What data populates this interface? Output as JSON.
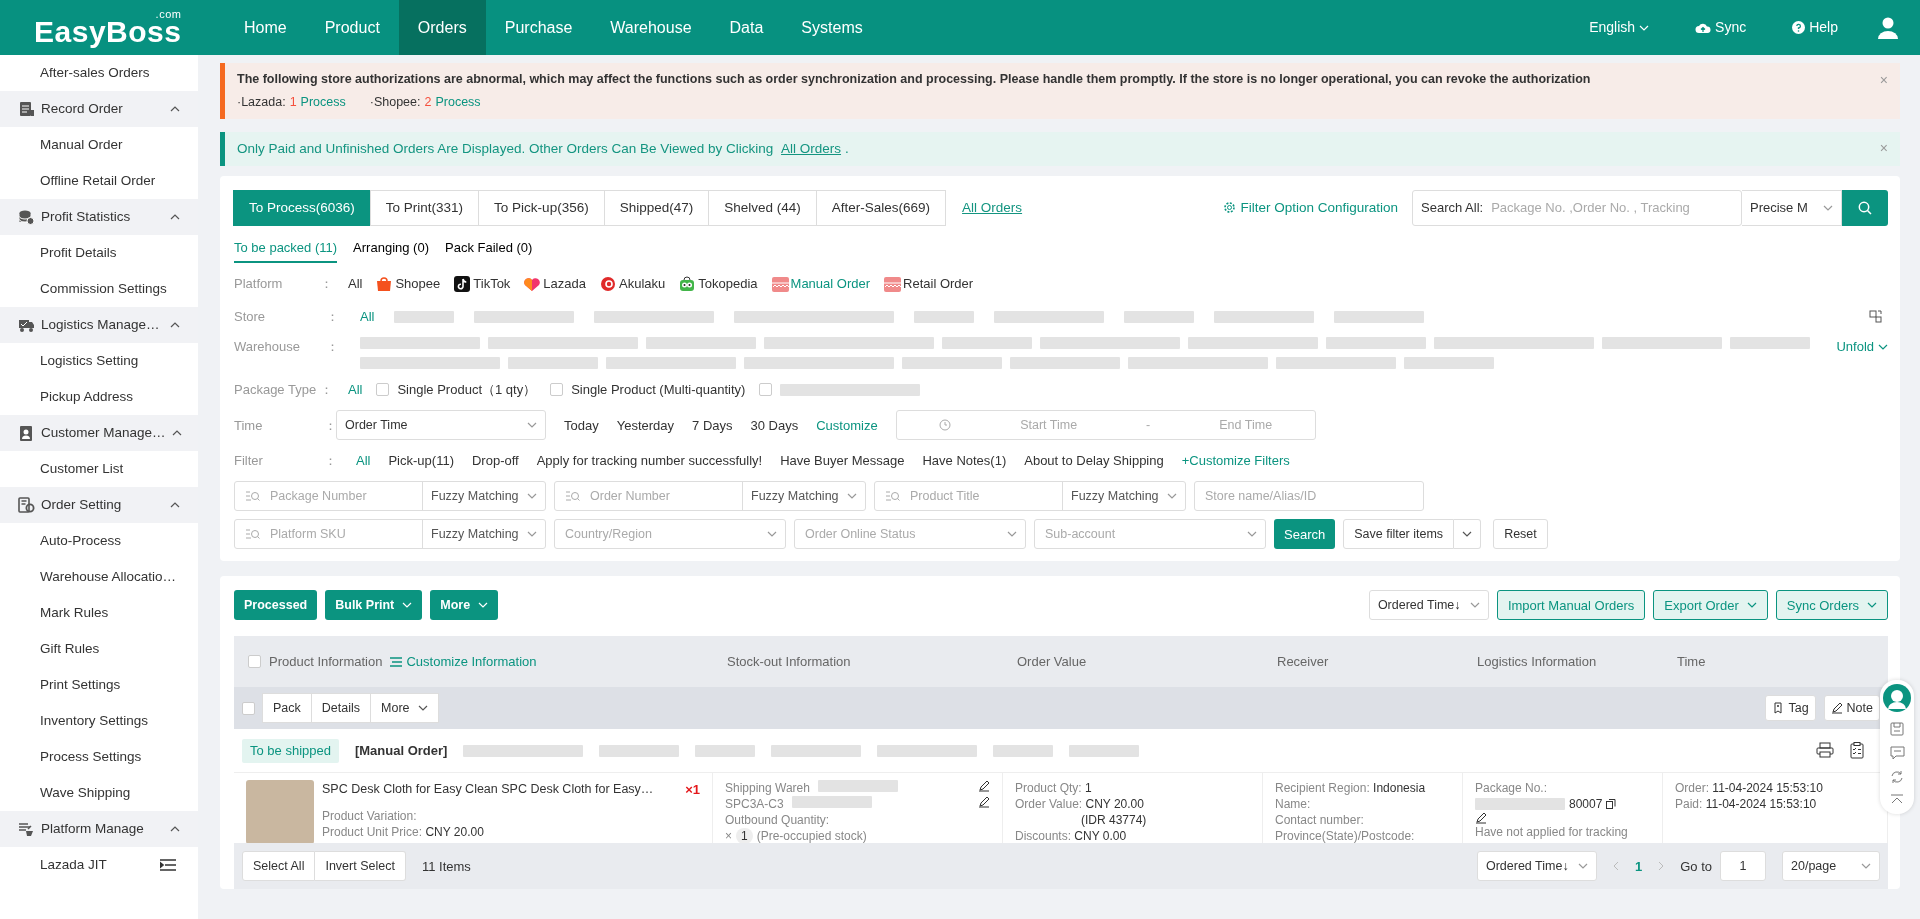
{
  "topbar": {
    "logo": "EasyBoss",
    "logo_suffix": ".com",
    "nav": [
      {
        "label": "Home",
        "selected": false
      },
      {
        "label": "Product",
        "selected": false
      },
      {
        "label": "Orders",
        "selected": true
      },
      {
        "label": "Purchase",
        "selected": false
      },
      {
        "label": "Warehouse",
        "selected": false
      },
      {
        "label": "Data",
        "selected": false
      },
      {
        "label": "Systems",
        "selected": false
      }
    ],
    "language": "English",
    "sync": "Sync",
    "help": "Help"
  },
  "sidebar": {
    "items": [
      {
        "kind": "link",
        "label": "After-sales Orders"
      },
      {
        "kind": "group",
        "label": "Record Order",
        "expanded": true,
        "children": [
          {
            "label": "Manual Order"
          },
          {
            "label": "Offline Retail Order"
          }
        ]
      },
      {
        "kind": "group",
        "label": "Profit Statistics",
        "expanded": true,
        "children": [
          {
            "label": "Profit Details"
          },
          {
            "label": "Commission Settings"
          }
        ]
      },
      {
        "kind": "group",
        "label": "Logistics Manage…",
        "expanded": true,
        "children": [
          {
            "label": "Logistics Setting"
          },
          {
            "label": "Pickup Address"
          }
        ]
      },
      {
        "kind": "group",
        "label": "Customer Manage…",
        "expanded": true,
        "children": [
          {
            "label": "Customer List"
          }
        ]
      },
      {
        "kind": "group",
        "label": "Order Setting",
        "expanded": true,
        "children": [
          {
            "label": "Auto-Process"
          },
          {
            "label": "Warehouse Allocatio…"
          },
          {
            "label": "Mark Rules"
          },
          {
            "label": "Gift Rules"
          },
          {
            "label": "Print Settings"
          },
          {
            "label": "Inventory Settings"
          },
          {
            "label": "Process Settings"
          },
          {
            "label": "Wave Shipping"
          }
        ]
      },
      {
        "kind": "group",
        "label": "Platform Manage",
        "expanded": true,
        "children": [
          {
            "label": "Lazada JIT",
            "menu": true
          }
        ]
      }
    ]
  },
  "alerts": [
    {
      "kind": "warning",
      "text": "The following store authorizations are abnormal, which may affect the functions such as order synchronization and processing. Please handle them promptly. If the store is no longer operational, you can revoke the authorization",
      "stores": [
        {
          "name": "·Lazada:",
          "count": "1",
          "action": "Process"
        },
        {
          "name": "·Shopee:",
          "count": "2",
          "action": "Process"
        }
      ],
      "close": "×"
    },
    {
      "kind": "info",
      "text": "Only Paid and Unfinished Orders Are Displayed. Other Orders Can Be Viewed by Clicking",
      "link": "All Orders",
      "suffix": ".",
      "close": "×"
    }
  ],
  "status_tabs": [
    {
      "label": "To Process(6036)",
      "selected": true
    },
    {
      "label": "To Print(331)",
      "selected": false
    },
    {
      "label": "To Pick-up(356)",
      "selected": false
    },
    {
      "label": "Shipped(47)",
      "selected": false
    },
    {
      "label": "Shelved (44)",
      "selected": false
    },
    {
      "label": "After-Sales(669)",
      "selected": false
    }
  ],
  "all_orders_link": "All Orders",
  "filter_config": "Filter Option Configuration",
  "search": {
    "label": "Search All:",
    "placeholder": "Package No. ,Order No. , Tracking",
    "mode": "Precise M"
  },
  "sub_tabs": [
    {
      "label": "To be packed (11)",
      "selected": true
    },
    {
      "label": "Arranging (0)",
      "selected": false
    },
    {
      "label": "Pack Failed (0)",
      "selected": false
    }
  ],
  "platform": {
    "label": "Platform",
    "colon": "：",
    "options": [
      {
        "label": "All",
        "selected": false
      },
      {
        "label": "Shopee",
        "selected": false
      },
      {
        "label": "TikTok",
        "selected": false
      },
      {
        "label": "Lazada",
        "selected": false
      },
      {
        "label": "Akulaku",
        "selected": false
      },
      {
        "label": "Tokopedia",
        "selected": false
      },
      {
        "label": "Manual Order",
        "selected": true
      },
      {
        "label": "Retail Order",
        "selected": false
      }
    ]
  },
  "store": {
    "label": "Store",
    "colon": "：",
    "options": [
      {
        "label": "All",
        "selected": true
      }
    ]
  },
  "warehouse": {
    "label": "Warehouse",
    "colon": "：",
    "unfold": "Unfold"
  },
  "package_type": {
    "label": "Package Type",
    "colon": "：",
    "options": [
      {
        "label": "All",
        "selected": true
      }
    ],
    "checks": [
      {
        "label": "Single Product（1 qty）",
        "checked": false
      },
      {
        "label": "Single Product (Multi-quantity)",
        "checked": false
      },
      {
        "checked": false
      }
    ]
  },
  "time": {
    "label": "Time",
    "colon": "：",
    "field": "Order Time",
    "options": [
      "Today",
      "Yesterday",
      "7 Days",
      "30 Days"
    ],
    "customize": "Customize",
    "start": "Start Time",
    "separator": "-",
    "end": "End Time"
  },
  "filter": {
    "label": "Filter",
    "colon": "：",
    "options": [
      {
        "label": "All",
        "selected": true
      },
      {
        "label": "Pick-up(11)",
        "selected": false
      },
      {
        "label": "Drop-off",
        "selected": false
      },
      {
        "label": "Apply for tracking number successfully!",
        "selected": false
      },
      {
        "label": "Have Buyer Message",
        "selected": false
      },
      {
        "label": "Have Notes(1)",
        "selected": false
      },
      {
        "label": "About to Delay Shipping",
        "selected": false
      }
    ],
    "customize": "+Customize Filters"
  },
  "search_rows": [
    [
      {
        "kind": "search",
        "placeholder": "Package Number",
        "match": "Fuzzy Matching"
      },
      {
        "kind": "search",
        "placeholder": "Order Number",
        "match": "Fuzzy Matching"
      },
      {
        "kind": "search",
        "placeholder": "Product Title",
        "match": "Fuzzy Matching"
      },
      {
        "kind": "text",
        "placeholder": "Store name/Alias/ID"
      }
    ],
    [
      {
        "kind": "search",
        "placeholder": "Platform SKU",
        "match": "Fuzzy Matching"
      },
      {
        "kind": "select",
        "placeholder": "Country/Region"
      },
      {
        "kind": "select",
        "placeholder": "Order Online Status"
      },
      {
        "kind": "select",
        "placeholder": "Sub-account"
      }
    ]
  ],
  "search_buttons": {
    "search": "Search",
    "save": "Save filter items",
    "reset": "Reset"
  },
  "toolbar": {
    "left": [
      {
        "label": "Processed",
        "dropdown": false
      },
      {
        "label": "Bulk Print",
        "dropdown": true
      },
      {
        "label": "More",
        "dropdown": true
      }
    ],
    "sort": "Ordered Time↓",
    "right": [
      {
        "label": "Import Manual Orders",
        "dropdown": false
      },
      {
        "label": "Export Order",
        "dropdown": true
      },
      {
        "label": "Sync Orders",
        "dropdown": true
      }
    ]
  },
  "table": {
    "columns": [
      "Product Information",
      "Stock-out Information",
      "Order Value",
      "Receiver",
      "Logistics Information",
      "Time"
    ],
    "customize": "Customize Information",
    "all_checked": false,
    "group_checked": false,
    "group_actions": [
      {
        "label": "Pack",
        "dropdown": false
      },
      {
        "label": "Details",
        "dropdown": false
      },
      {
        "label": "More",
        "dropdown": true
      }
    ],
    "row_actions": [
      {
        "label": "Tag"
      },
      {
        "label": "Note"
      }
    ],
    "orders": [
      {
        "status": "To be shipped",
        "source": "[Manual Order]",
        "title": "SPC Desk Cloth for Easy Clean SPC Desk Cloth for Easy…",
        "qty": "×1",
        "product_lines": [
          {
            "label": "Product Variation:"
          },
          {
            "label": "Product Unit Price:",
            "value": "CNY 20.00"
          }
        ],
        "stock_lines": [
          "Shipping Wareh",
          "SPC3A-C3",
          "Outbound Quantity:"
        ],
        "stock_qty": {
          "mark": "×",
          "count": "1",
          "note": "(Pre-occupied stock)"
        },
        "value_lines": [
          {
            "label": "Product Qty:",
            "value": "1"
          },
          {
            "label": "Order Value:",
            "value": "CNY 20.00"
          },
          {
            "value": "(IDR 43774)"
          },
          {
            "label": "Discounts:",
            "value": "CNY 0.00"
          }
        ],
        "receiver_lines": [
          {
            "label": "Recipient Region:",
            "value": "Indonesia"
          },
          {
            "label": "Name:"
          },
          {
            "label": "Contact number:"
          },
          {
            "label": "Province(State)/Postcode:"
          }
        ],
        "logistics": {
          "label": "Package No.:",
          "number": "80007",
          "note": "Have not applied for tracking"
        },
        "times": [
          {
            "label": "Order:",
            "value": "11-04-2024 15:53:10"
          },
          {
            "label": "Paid:",
            "value": "11-04-2024 15:53:10"
          }
        ]
      }
    ]
  },
  "footer": {
    "select_all": "Select All",
    "invert": "Invert Select",
    "count": "11 Items",
    "sort": "Ordered Time↓",
    "page": "1",
    "goto": "Go to",
    "goto_value": "1",
    "per_page": "20/page"
  }
}
